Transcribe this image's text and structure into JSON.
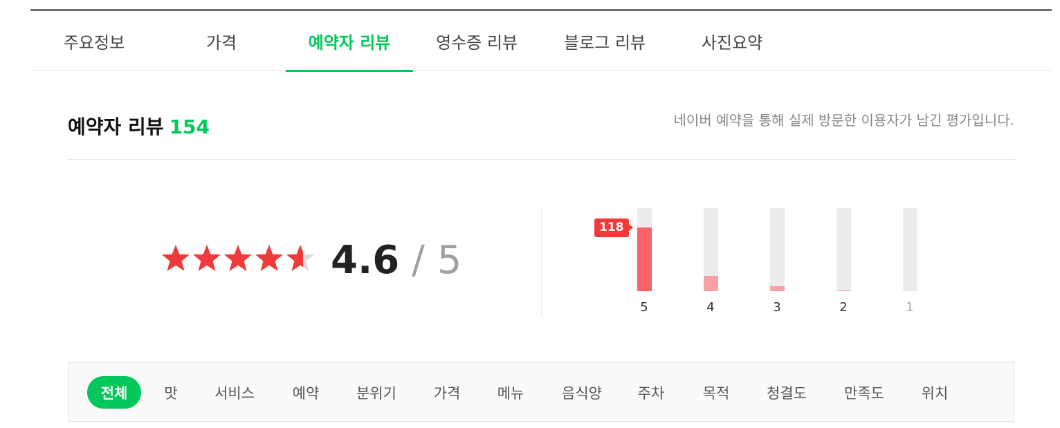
{
  "tabs": [
    {
      "label": "주요정보",
      "active": false
    },
    {
      "label": "가격",
      "active": false
    },
    {
      "label": "예약자 리뷰",
      "active": true
    },
    {
      "label": "영수증 리뷰",
      "active": false
    },
    {
      "label": "블로그 리뷰",
      "active": false
    },
    {
      "label": "사진요약",
      "active": false
    }
  ],
  "section": {
    "title": "예약자 리뷰",
    "count": "154",
    "description": "네이버 예약을 통해 실제 방문한 이용자가 남긴 평가입니다."
  },
  "rating": {
    "value": "4.6",
    "separator": "/",
    "max": "5",
    "stars_filled": 4.6
  },
  "distribution": {
    "bars": [
      {
        "label": "5",
        "fraction": 0.77,
        "highlight": true
      },
      {
        "label": "4",
        "fraction": 0.18
      },
      {
        "label": "3",
        "fraction": 0.06
      },
      {
        "label": "2",
        "fraction": 0.01
      },
      {
        "label": "1",
        "fraction": 0.0
      }
    ],
    "badge": "118"
  },
  "filters": [
    {
      "label": "전체",
      "active": true
    },
    {
      "label": "맛"
    },
    {
      "label": "서비스"
    },
    {
      "label": "예약"
    },
    {
      "label": "분위기"
    },
    {
      "label": "가격"
    },
    {
      "label": "메뉴"
    },
    {
      "label": "음식양"
    },
    {
      "label": "주차"
    },
    {
      "label": "목적"
    },
    {
      "label": "청결도"
    },
    {
      "label": "만족도"
    },
    {
      "label": "위치"
    }
  ],
  "colors": {
    "accent": "#03c75a",
    "star": "#ef3a3a",
    "star_empty": "#dcdcdc",
    "bar_strong": "#f5646a",
    "bar_light": "#f7a1a4",
    "track": "#ececec"
  },
  "icons": {
    "star": "star-icon"
  }
}
